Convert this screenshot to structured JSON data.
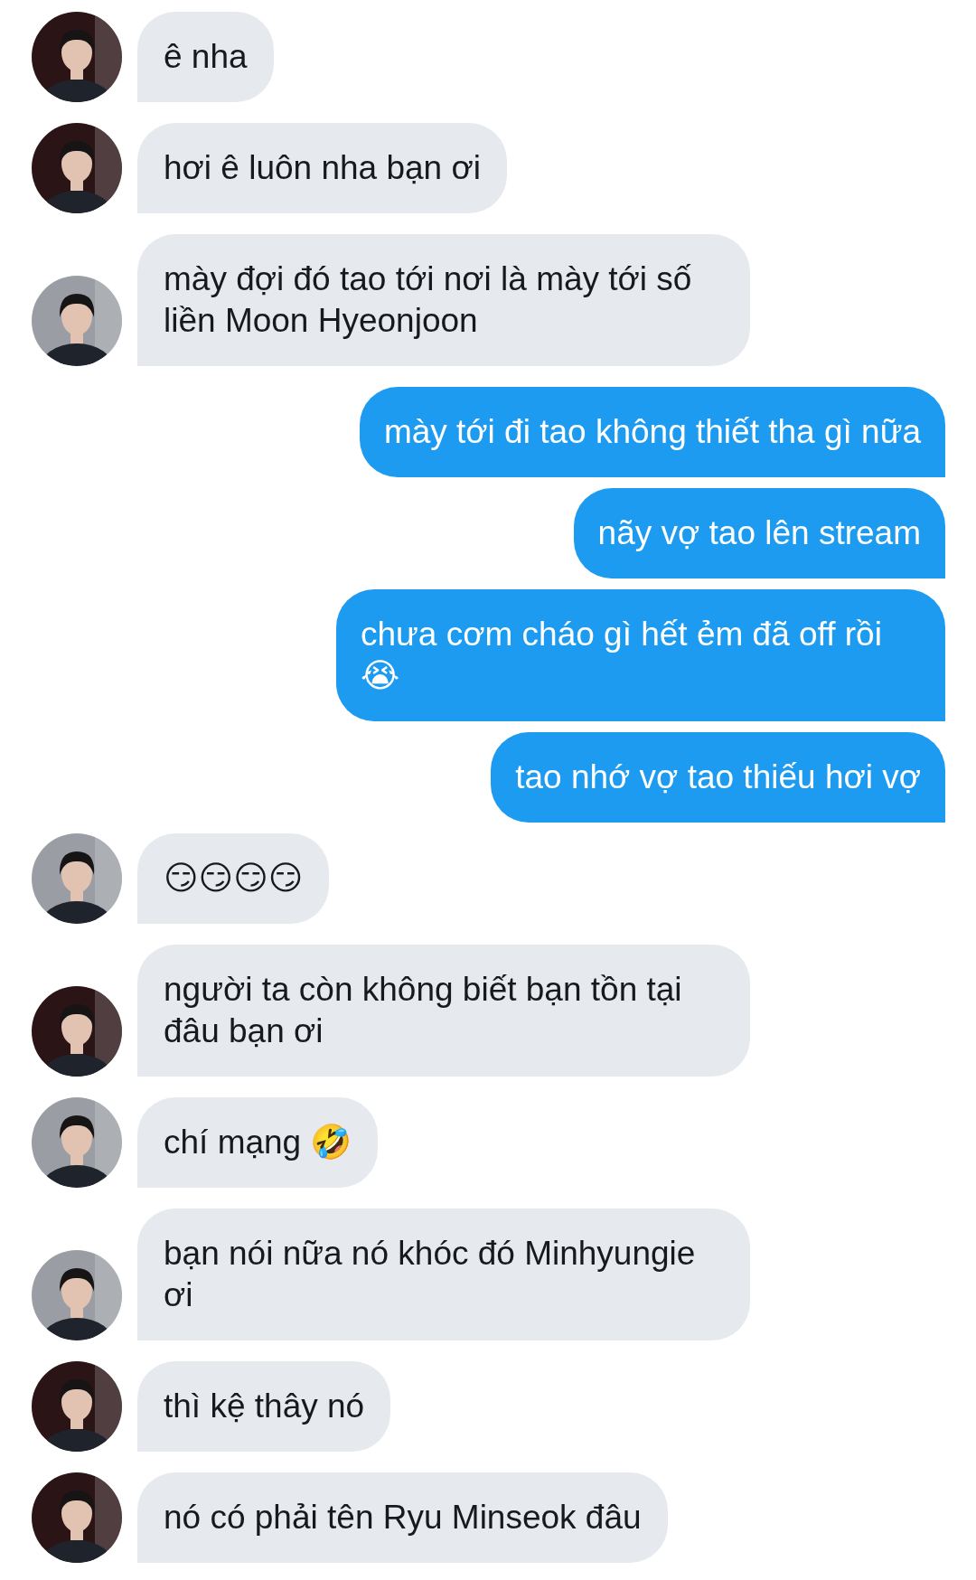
{
  "messages": [
    {
      "kind": "received",
      "avatar": {
        "color": "#2a1416"
      },
      "text": "ê nha"
    },
    {
      "kind": "received",
      "avatar": {
        "color": "#2a1416"
      },
      "text": "hơi ê luôn nha bạn ơi"
    },
    {
      "kind": "received",
      "avatar": {
        "color": "#9a9ea4"
      },
      "text": "mày đợi đó tao tới nơi là mày tới số liền Moon Hyeonjoon"
    },
    {
      "kind": "sent",
      "text": "mày tới đi tao không thiết tha gì nữa"
    },
    {
      "kind": "sent",
      "text": "nãy vợ tao lên stream"
    },
    {
      "kind": "sent",
      "text": "chưa cơm cháo gì hết ẻm đã off rồi 😭"
    },
    {
      "kind": "sent",
      "text": "tao nhớ vợ tao thiếu hơi vợ"
    },
    {
      "kind": "received",
      "avatar": {
        "color": "#9a9ea4"
      },
      "text": "😏😏😏😏"
    },
    {
      "kind": "received",
      "avatar": {
        "color": "#2a1416"
      },
      "text": "người ta còn không biết bạn tồn tại đâu bạn ơi"
    },
    {
      "kind": "received",
      "avatar": {
        "color": "#9a9ea4"
      },
      "text": "chí mạng 🤣"
    },
    {
      "kind": "received",
      "avatar": {
        "color": "#9a9ea4"
      },
      "text": "bạn nói nữa nó khóc đó Minhyungie ơi"
    },
    {
      "kind": "received",
      "avatar": {
        "color": "#2a1416"
      },
      "text": "thì kệ thây nó"
    },
    {
      "kind": "received",
      "avatar": {
        "color": "#2a1416"
      },
      "text": "nó có phải tên Ryu Minseok đâu"
    }
  ]
}
